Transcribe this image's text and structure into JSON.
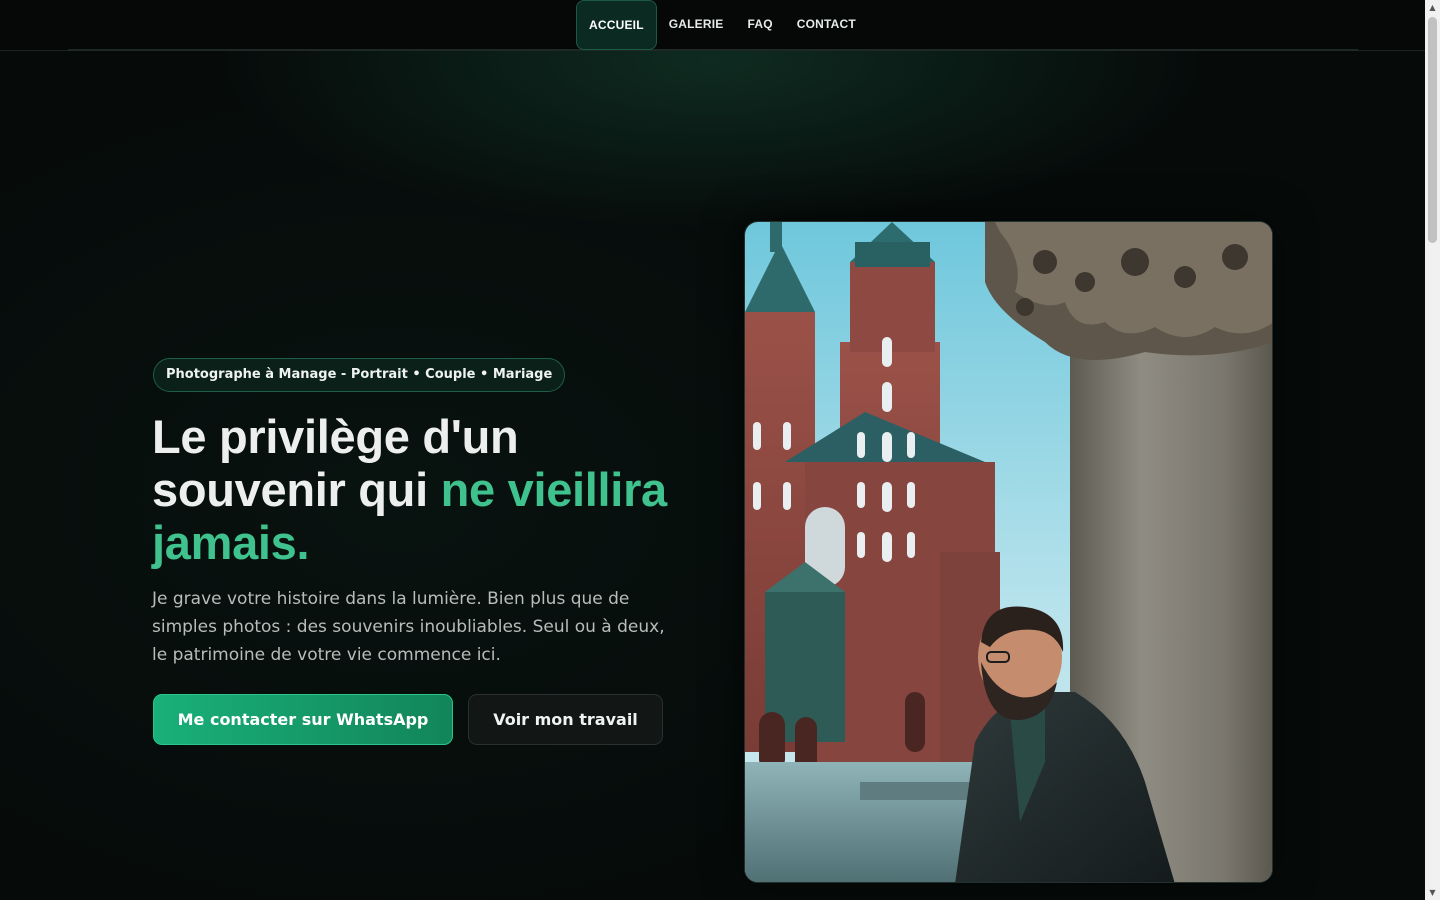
{
  "nav": {
    "items": [
      {
        "label": "ACCUEIL",
        "active": true
      },
      {
        "label": "GALERIE",
        "active": false
      },
      {
        "label": "FAQ",
        "active": false
      },
      {
        "label": "CONTACT",
        "active": false
      }
    ]
  },
  "hero": {
    "badge": "Photographe à Manage - Portrait • Couple • Mariage",
    "title_part1": "Le privilège d'un souvenir qui ",
    "title_accent": "ne vieillira jamais.",
    "lead": "Je grave votre histoire dans la lumière. Bien plus que de simples photos : des souvenirs inoubliables. Seul ou à deux, le patrimoine de votre vie commence ici.",
    "primary_button": "Me contacter sur WhatsApp",
    "secondary_button": "Voir mon travail"
  },
  "colors": {
    "accent": "#3fc28e",
    "primary_button": "#19b07a",
    "background": "#060b0a"
  },
  "photo": {
    "subject": "man-beside-column-in-front-of-brick-church"
  },
  "scrollbar": {
    "up_icon": "triangle-up-icon",
    "down_icon": "triangle-down-icon"
  }
}
